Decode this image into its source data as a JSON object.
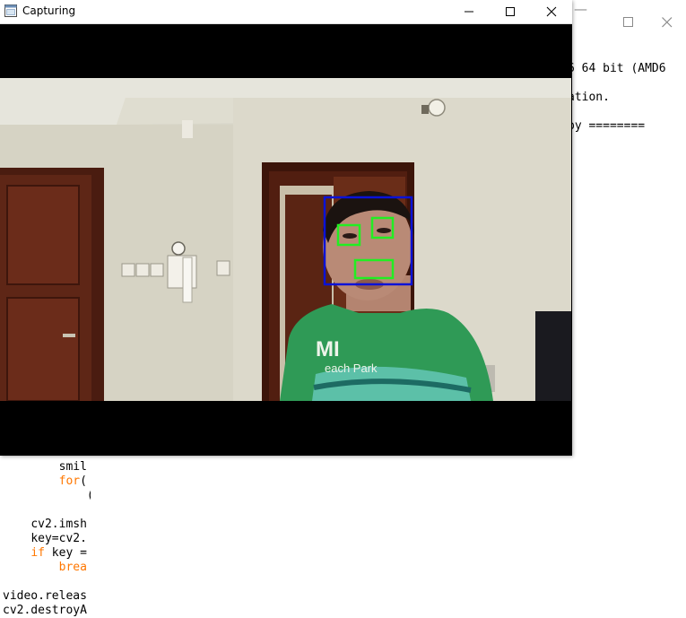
{
  "shell": {
    "output_lines": [
      "6 64 bit (AMD6",
      "ation.",
      "py ========"
    ]
  },
  "editor": {
    "lines": [
      {
        "indent": "        ",
        "keyword": "",
        "text": "smil"
      },
      {
        "indent": "        ",
        "keyword": "for",
        "text": "("
      },
      {
        "indent": "            ",
        "keyword": "",
        "text": "("
      },
      {
        "indent": "    ",
        "keyword": "",
        "text": "cv2.imsh"
      },
      {
        "indent": "    ",
        "keyword": "",
        "text": "key=cv2."
      },
      {
        "indent": "    ",
        "keyword": "if",
        "text": " key ="
      },
      {
        "indent": "        ",
        "keyword": "brea",
        "text": ""
      },
      {
        "indent": "",
        "keyword": "",
        "text": "video.releas"
      },
      {
        "indent": "",
        "keyword": "",
        "text": "cv2.destroyA"
      }
    ]
  },
  "capture_window": {
    "title": "Capturing",
    "shirt_text_1": "MI",
    "shirt_text_2": "each Park",
    "detections": {
      "face_color": "#0a12d8",
      "feature_color": "#22ee22"
    }
  },
  "colors": {
    "keyword": "#ff7700",
    "titlebar": "#ffffff",
    "letterbox": "#000000"
  }
}
